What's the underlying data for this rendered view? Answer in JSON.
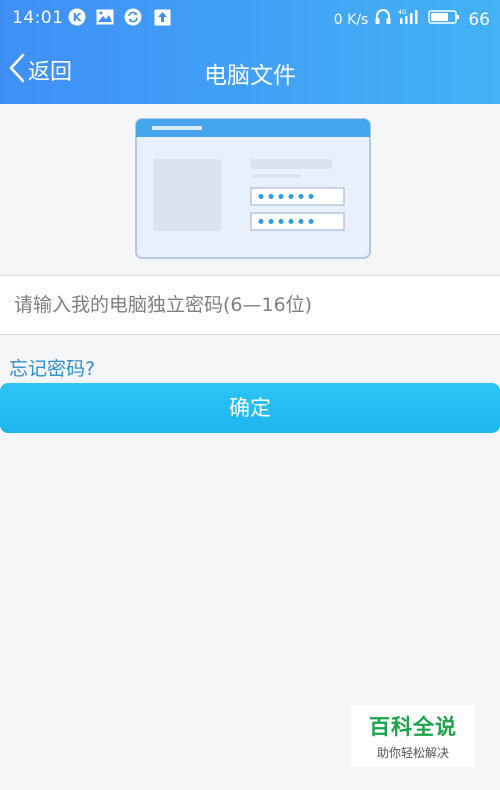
{
  "status_bar": {
    "time": "14:01",
    "icons_left": [
      "k-app-icon",
      "image-icon",
      "sync-icon",
      "upload-icon"
    ],
    "speed": "0 K/s",
    "battery": "66",
    "icons_right": [
      "headphone-icon",
      "signal-icon",
      "battery-icon"
    ]
  },
  "nav": {
    "back_label": "返回",
    "title": "电脑文件"
  },
  "form": {
    "password_placeholder": "请输入我的电脑独立密码(6—16位)",
    "forgot_label": "忘记密码?",
    "confirm_label": "确定"
  },
  "watermark": {
    "title": "百科全说",
    "subtitle": "助你轻松解决"
  },
  "colors": {
    "header_start": "#3f8ff7",
    "header_end": "#43b2f6",
    "button": "#25bdf2",
    "link": "#2f8fcf"
  }
}
